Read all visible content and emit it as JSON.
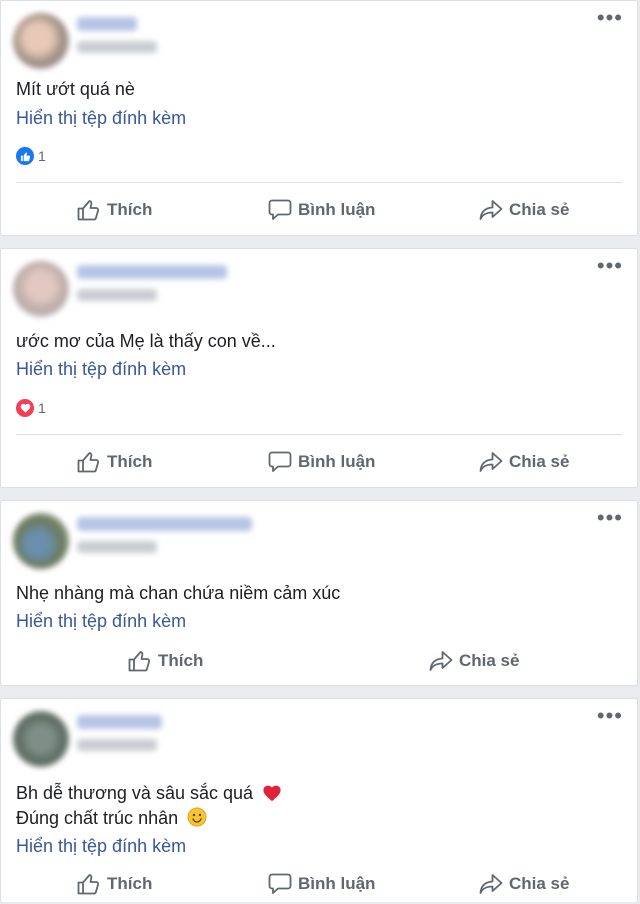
{
  "posts": [
    {
      "text": "Mít ướt quá nè",
      "attachment_link": "Hiển thị tệp đính kèm",
      "reaction": {
        "type": "like",
        "count": "1",
        "color": "#1877f2"
      },
      "actions": {
        "like": "Thích",
        "comment": "Bình luận",
        "share": "Chia sẻ"
      }
    },
    {
      "text": "ước mơ của Mẹ là thấy con về...",
      "attachment_link": "Hiển thị tệp đính kèm",
      "reaction": {
        "type": "love",
        "count": "1",
        "color": "#f33e58"
      },
      "actions": {
        "like": "Thích",
        "comment": "Bình luận",
        "share": "Chia sẻ"
      }
    },
    {
      "text": "Nhẹ nhàng mà chan chứa niềm cảm xúc",
      "attachment_link": "Hiển thị tệp đính kèm",
      "actions": {
        "like": "Thích",
        "share": "Chia sẻ"
      }
    },
    {
      "text_line1": "Bh dễ thương và sâu sắc quá",
      "text_line2": "Đúng chất trúc nhân",
      "attachment_link": "Hiển thị tệp đính kèm",
      "actions": {
        "like": "Thích",
        "comment": "Bình luận",
        "share": "Chia sẻ"
      }
    }
  ],
  "colors": {
    "link": "#385898",
    "muted": "#606770",
    "background": "#e9ebee"
  }
}
